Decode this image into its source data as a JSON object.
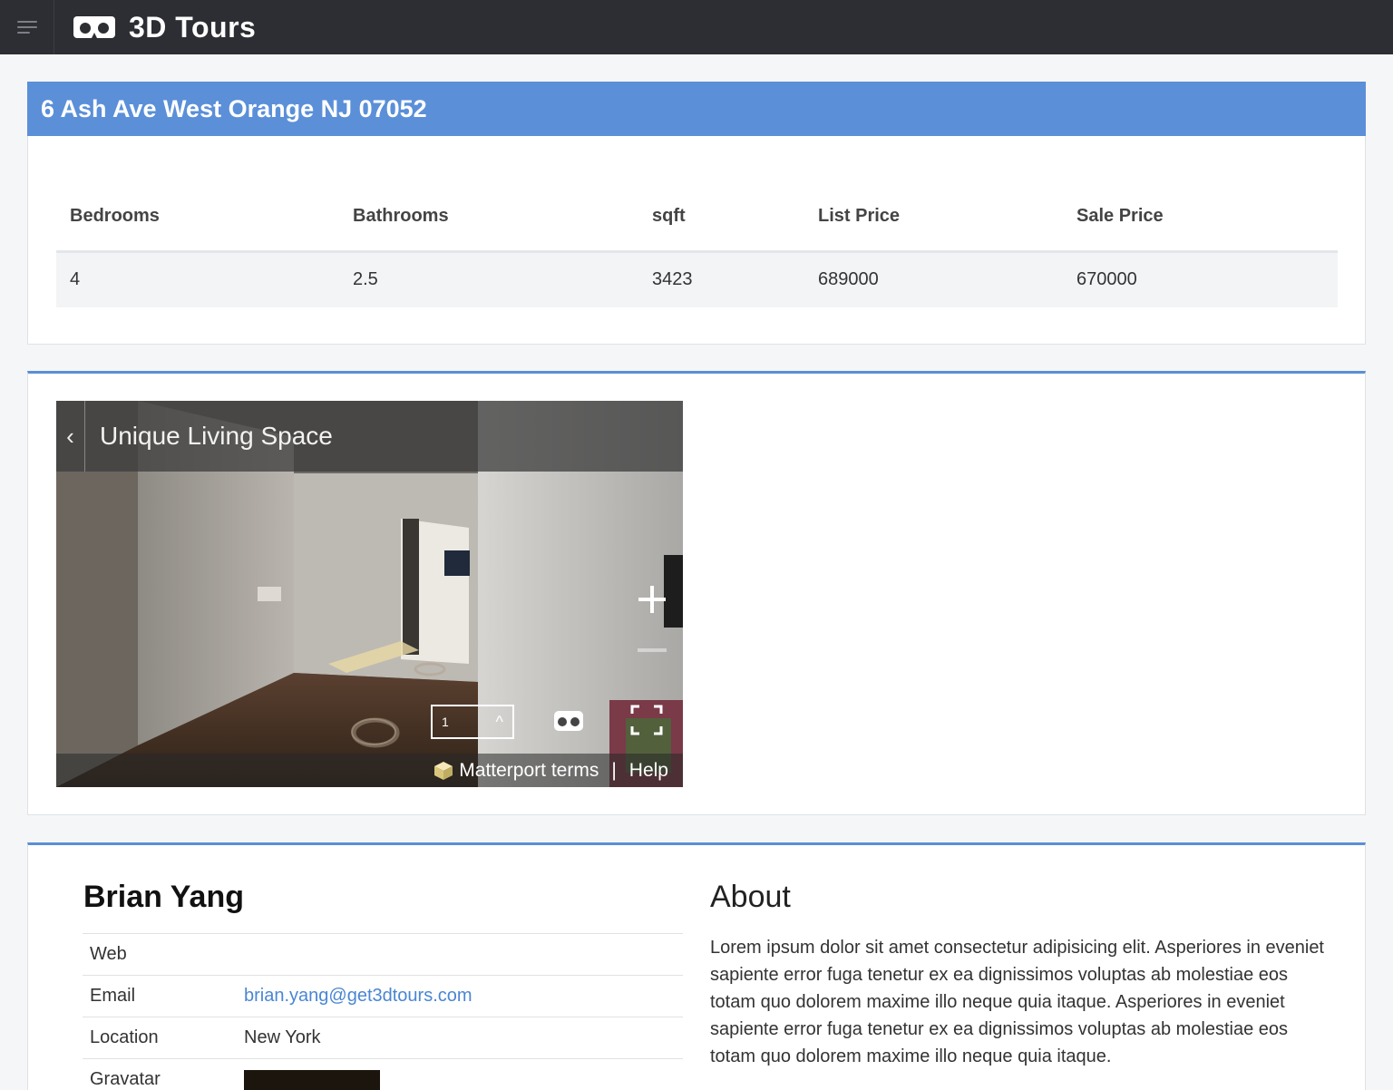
{
  "app": {
    "title": "3D Tours",
    "colors": {
      "topbar": "#2c2e33",
      "accent": "#5b8fd8",
      "link": "#4a86d3"
    }
  },
  "property": {
    "address": "6 Ash Ave West Orange NJ 07052",
    "columns": [
      "Bedrooms",
      "Bathrooms",
      "sqft",
      "List Price",
      "Sale Price"
    ],
    "values": [
      "4",
      "2.5",
      "3423",
      "689000",
      "670000"
    ]
  },
  "tour": {
    "title": "Unique Living Space",
    "back_icon": "chevron-left-icon",
    "floor": "1",
    "footer_terms": "Matterport terms",
    "footer_sep": "|",
    "footer_help": "Help"
  },
  "agent": {
    "name": "Brian Yang",
    "rows": [
      {
        "label": "Web",
        "value": ""
      },
      {
        "label": "Email",
        "value": "brian.yang@get3dtours.com"
      },
      {
        "label": "Location",
        "value": "New York"
      },
      {
        "label": "Gravatar",
        "value": ""
      }
    ],
    "about_title": "About",
    "about_text": "Lorem ipsum dolor sit amet consectetur adipisicing elit. Asperiores in eveniet sapiente error fuga tenetur ex ea dignissimos voluptas ab molestiae eos totam quo dolorem maxime illo neque quia itaque. Asperiores in eveniet sapiente error fuga tenetur ex ea dignissimos voluptas ab molestiae eos totam quo dolorem maxime illo neque quia itaque."
  }
}
